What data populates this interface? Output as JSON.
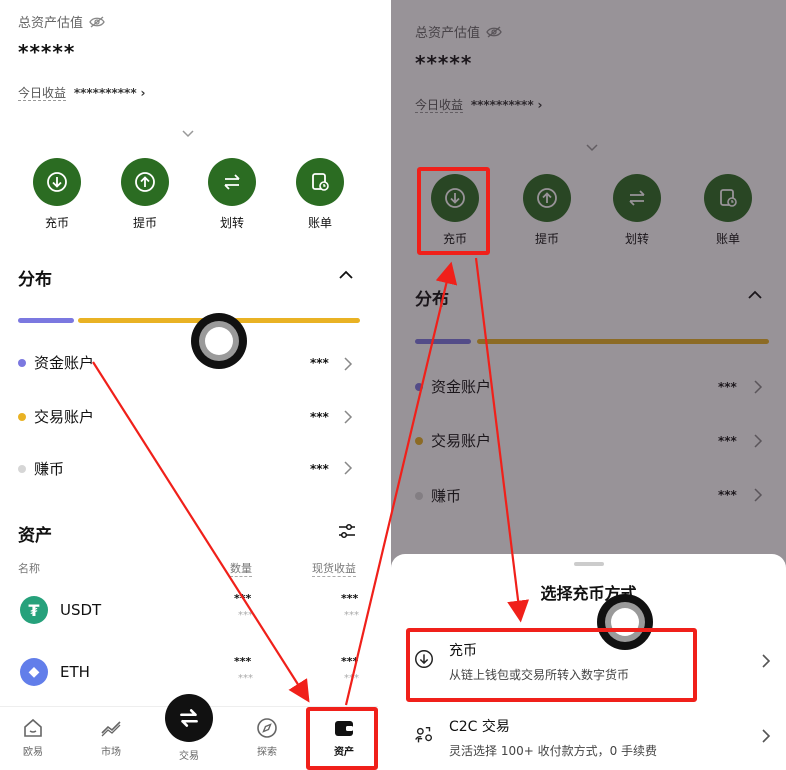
{
  "left": {
    "total_label": "总资产估值",
    "total_value": "*****",
    "today_label": "今日收益",
    "today_value": "**********",
    "actions": [
      {
        "label": "充币",
        "icon": "deposit-icon"
      },
      {
        "label": "提币",
        "icon": "withdraw-icon"
      },
      {
        "label": "划转",
        "icon": "transfer-icon"
      },
      {
        "label": "账单",
        "icon": "bill-icon"
      }
    ],
    "distribution_title": "分布",
    "accounts": [
      {
        "label": "资金账户",
        "value": "***",
        "color": "#7b78e0"
      },
      {
        "label": "交易账户",
        "value": "***",
        "color": "#e9b224"
      },
      {
        "label": "赚币",
        "value": "***",
        "color": "#d6d6d6"
      }
    ],
    "assets_title": "资产",
    "columns": {
      "name": "名称",
      "qty": "数量",
      "pnl": "现货收益"
    },
    "coins": [
      {
        "name": "USDT",
        "qty": "***",
        "qty2": "***",
        "pnl": "***",
        "pnl2": "***",
        "color": "#26a17b",
        "glyph": "₮"
      },
      {
        "name": "ETH",
        "qty": "***",
        "qty2": "***",
        "pnl": "***",
        "pnl2": "***",
        "color": "#627eea",
        "glyph": "◆"
      }
    ],
    "nav": [
      {
        "label": "欧易",
        "icon": "home-icon"
      },
      {
        "label": "市场",
        "icon": "market-icon"
      },
      {
        "label": "交易",
        "icon": "trade-icon"
      },
      {
        "label": "探索",
        "icon": "explore-icon"
      },
      {
        "label": "资产",
        "icon": "wallet-icon"
      }
    ]
  },
  "right": {
    "total_label": "总资产估值",
    "total_value": "*****",
    "today_label": "今日收益",
    "today_value": "**********",
    "actions": [
      {
        "label": "充币"
      },
      {
        "label": "提币"
      },
      {
        "label": "划转"
      },
      {
        "label": "账单"
      }
    ],
    "distribution_title": "分布",
    "accounts": [
      {
        "label": "资金账户",
        "value": "***"
      },
      {
        "label": "交易账户",
        "value": "***"
      },
      {
        "label": "赚币",
        "value": "***"
      }
    ],
    "sheet": {
      "title": "选择充币方式",
      "options": [
        {
          "title": "充币",
          "desc": "从链上钱包或交易所转入数字货币",
          "icon": "deposit-icon"
        },
        {
          "title": "C2C 交易",
          "desc": "灵活选择 100+ 收付款方式，0 手续费",
          "icon": "c2c-icon"
        }
      ]
    }
  },
  "colors": {
    "brand_green": "#2b6c22",
    "annotation_red": "#f0201a"
  }
}
